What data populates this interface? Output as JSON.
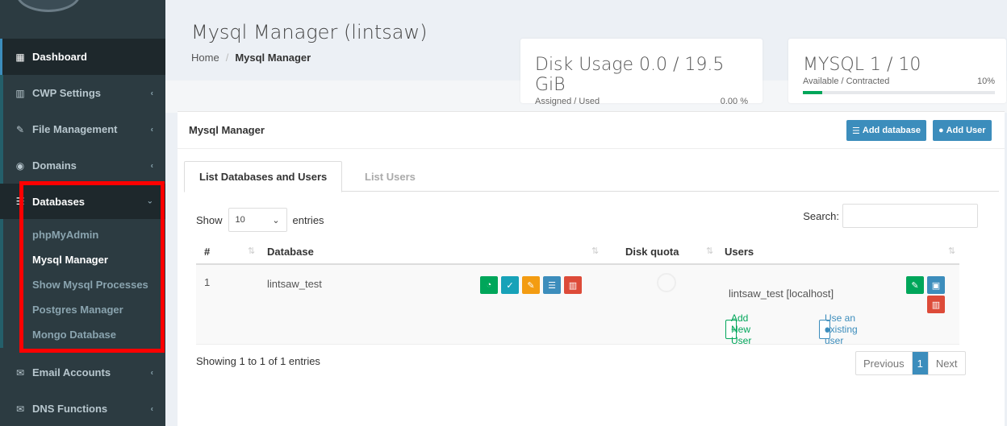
{
  "sidebar": {
    "items": [
      {
        "label": "Dashboard",
        "icon": "grid-icon",
        "glyph": "▦"
      },
      {
        "label": "CWP Settings",
        "icon": "bar-chart-icon",
        "glyph": "▥"
      },
      {
        "label": "File Management",
        "icon": "edit-icon",
        "glyph": "✎"
      },
      {
        "label": "Domains",
        "icon": "globe-icon",
        "glyph": "◉"
      },
      {
        "label": "Databases",
        "icon": "database-icon",
        "glyph": "☰"
      },
      {
        "label": "Email Accounts",
        "icon": "envelope-icon",
        "glyph": "✉"
      },
      {
        "label": "DNS Functions",
        "icon": "envelope-icon",
        "glyph": "✉"
      }
    ],
    "databases_submenu": [
      "phpMyAdmin",
      "Mysql Manager",
      "Show Mysql Processes",
      "Postgres Manager",
      "Mongo Database"
    ]
  },
  "header": {
    "title": "Mysql Manager (lintsaw)",
    "breadcrumb_home": "Home",
    "breadcrumb_sep": "/",
    "breadcrumb_current": "Mysql Manager"
  },
  "disk_card": {
    "title": "Disk Usage 0.0 / 19.5 GiB",
    "label": "Assigned / Used",
    "percent": "0.00 %",
    "fill_fraction": 0.0
  },
  "mysql_card": {
    "title": "MYSQL 1 / 10",
    "label": "Available / Contracted",
    "percent": "10%",
    "fill_fraction": 0.1
  },
  "box": {
    "title": "Mysql Manager",
    "add_database": "Add database",
    "add_user": "Add User"
  },
  "tabs": [
    "List Databases and Users",
    "List Users"
  ],
  "table_controls": {
    "show": "Show",
    "entries_value": "10",
    "entries": "entries",
    "search": "Search:"
  },
  "table": {
    "headers": [
      "#",
      "Database",
      "Disk quota",
      "Users"
    ],
    "rows": [
      {
        "num": "1",
        "database": "lintsaw_test",
        "user": "lintsaw_test [localhost]"
      }
    ],
    "add_new_user": "Add New User",
    "use_existing_user": "Use an existing user"
  },
  "footer": {
    "info": "Showing 1 to 1 of 1 entries",
    "previous": "Previous",
    "page": "1",
    "next": "Next"
  },
  "colors": {
    "sidebar_bg": "#2c3b41",
    "primary": "#3c8dbc",
    "success": "#00a65a",
    "info": "#17a2b8",
    "warning": "#f39c12",
    "danger": "#dd4b39",
    "highlight": "#ff0000"
  }
}
